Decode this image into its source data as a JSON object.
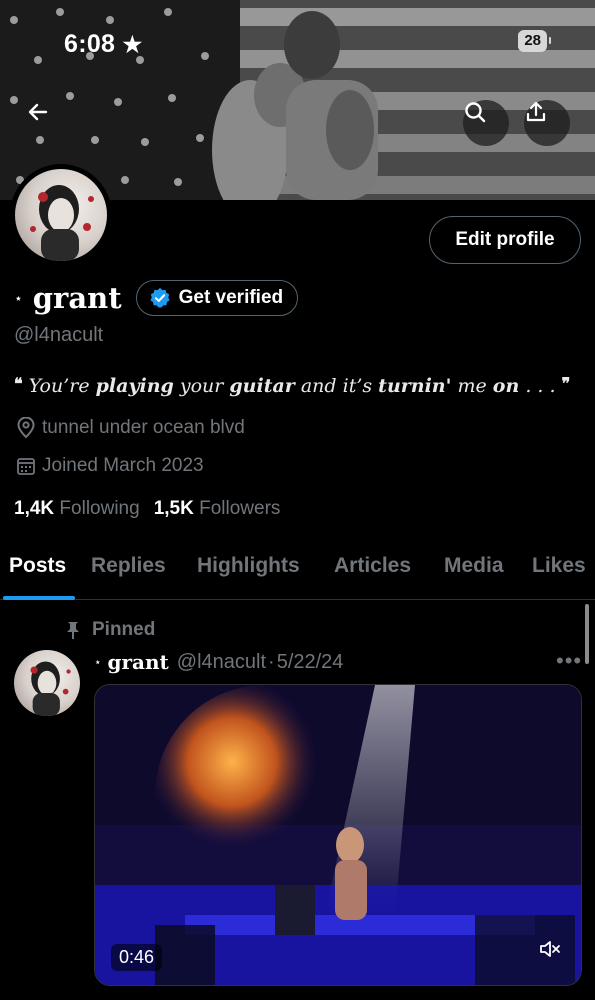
{
  "status_bar": {
    "time": "6:08",
    "battery": "28"
  },
  "profile": {
    "name": "grant",
    "name_prefix": "⋆",
    "handle": "@l4nacult",
    "edit_button": "Edit profile",
    "get_verified": "Get verified",
    "bio": {
      "open_quote": "❝",
      "p1": "You’re ",
      "b1": "playing",
      "p2": " your ",
      "b2": "guitar",
      "p3": " and it’s ",
      "b3": "turnin'",
      "p4": " me ",
      "b4": "on",
      "p5": " . . .",
      "close_quote": "❞"
    },
    "location": "tunnel under ocean blvd",
    "joined": "Joined March 2023",
    "following_count": "1,4K",
    "following_label": "Following",
    "followers_count": "1,5K",
    "followers_label": "Followers"
  },
  "tabs": [
    "Posts",
    "Replies",
    "Highlights",
    "Articles",
    "Media",
    "Likes"
  ],
  "active_tab": "Posts",
  "pinned_post": {
    "pinned_label": "Pinned",
    "author_prefix": "⋆",
    "author_name": "grant",
    "author_handle": "@l4nacult",
    "separator": "·",
    "date": "5/22/24",
    "video_duration": "0:46"
  },
  "icons": {
    "back": "arrow-left-icon",
    "search": "search-icon",
    "share": "share-icon",
    "verified": "verified-badge-icon",
    "location": "location-pin-icon",
    "calendar": "calendar-icon",
    "pin": "pin-icon",
    "more": "more-dots-icon",
    "mute": "muted-speaker-icon"
  },
  "colors": {
    "accent": "#1d9bf0",
    "muted_text": "#71767b",
    "background": "#000000"
  }
}
